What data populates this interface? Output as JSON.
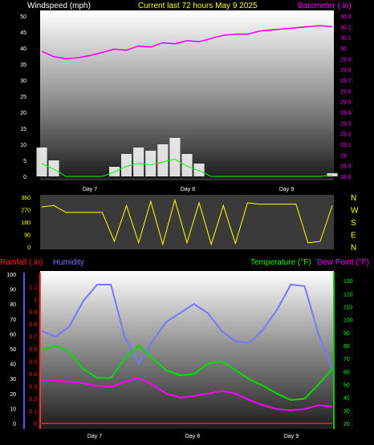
{
  "header": {
    "left": "Windspeed (mph)",
    "center": "Current last 72 hours May 9 2025",
    "right": "Barometer (.in)"
  },
  "day_labels": [
    "Day 7",
    "Day 8",
    "Day 9"
  ],
  "colors": {
    "wind_bars": "#ffffff",
    "gust_line": "#00ff00",
    "avg_line": "#004400",
    "barometer": "#ff00ff",
    "direction": "#ffff00",
    "humidity": "#7777ff",
    "temperature": "#00e000",
    "dew_point": "#ff00ff",
    "rainfall": "#ff2222",
    "label_white": "#ffffff",
    "label_yellow": "#ffff00",
    "label_green": "#00ff00",
    "label_magenta": "#ff00ff"
  },
  "chart_data": [
    {
      "type": "line",
      "title": "Current last 72 hours May 9 2025",
      "ylabel": "Windspeed (mph)",
      "ylabel_right": "Barometer (.in)",
      "ylim": [
        0,
        50
      ],
      "ylim_right": [
        28.8,
        30.3
      ],
      "yticks": [
        0,
        5,
        10,
        15,
        20,
        25,
        30,
        35,
        40,
        45,
        50
      ],
      "yticks_right": [
        "28.8",
        "28.9",
        "29",
        "29.1",
        "29.2",
        "29.3",
        "29.4",
        "29.5",
        "29.6",
        "29.7",
        "29.8",
        "29.9",
        "30",
        "30.1",
        "30.2",
        "30.3"
      ],
      "x_hours": [
        0,
        6,
        12,
        18,
        24,
        30,
        36,
        42,
        48,
        54,
        60,
        66,
        72
      ],
      "x_day_labels": [
        "Day 7",
        "Day 8",
        "Day 9"
      ],
      "series": [
        {
          "name": "Windspeed",
          "values": [
            9,
            5,
            0,
            0,
            0,
            0,
            3,
            7,
            9,
            8,
            10,
            12,
            7,
            4,
            0,
            0,
            0,
            0,
            0,
            0,
            0,
            0,
            0,
            0,
            1
          ]
        },
        {
          "name": "Barometer",
          "values": [
            29.97,
            29.92,
            29.9,
            29.91,
            29.93,
            29.96,
            29.99,
            29.98,
            30.02,
            30.01,
            30.05,
            30.04,
            30.07,
            30.06,
            30.09,
            30.12,
            30.13,
            30.13,
            30.16,
            30.17,
            30.18,
            30.19,
            30.2,
            30.21,
            30.2
          ]
        }
      ]
    },
    {
      "type": "line",
      "ylabel_right_letters": [
        "N",
        "W",
        "S",
        "E",
        "N"
      ],
      "ylim": [
        0,
        360
      ],
      "yticks": [
        0,
        90,
        180,
        270,
        360
      ],
      "x_day_labels": [
        "Day 7",
        "Day 8",
        "Day 9"
      ],
      "series": [
        {
          "name": "Wind direction",
          "values": [
            290,
            300,
            250,
            250,
            250,
            250,
            40,
            300,
            30,
            330,
            20,
            340,
            30,
            320,
            20,
            300,
            25,
            320,
            310,
            310,
            310,
            310,
            30,
            40,
            300
          ]
        }
      ]
    },
    {
      "type": "line",
      "ylabels_left": [
        "Rainfall (.in)",
        "Humidity"
      ],
      "ylabels_right": [
        "Temperature (°F)",
        "Dew Point (°F)"
      ],
      "ylim_humidity": [
        0,
        100
      ],
      "ylim_rainfall": [
        0,
        1.2
      ],
      "ylim_temperature": [
        20,
        135
      ],
      "yticks_humidity": [
        0,
        10,
        20,
        30,
        40,
        50,
        60,
        70,
        80,
        90,
        100
      ],
      "yticks_rainfall": [
        "0",
        "0.1",
        "0.2",
        "0.3",
        "0.4",
        "0.5",
        "0.6",
        "0.7",
        "0.8",
        "0.9",
        "1",
        "1.1"
      ],
      "yticks_temperature": [
        20,
        30,
        40,
        50,
        60,
        70,
        80,
        90,
        100,
        110,
        120,
        130
      ],
      "x_day_labels": [
        "Day 7",
        "Day 8",
        "Day 9"
      ],
      "series": [
        {
          "name": "Humidity",
          "values": [
            62,
            58,
            65,
            82,
            93,
            93,
            58,
            40,
            55,
            68,
            74,
            80,
            74,
            62,
            55,
            54,
            63,
            76,
            93,
            92,
            60,
            36
          ]
        },
        {
          "name": "Temperature",
          "values": [
            77,
            80,
            75,
            62,
            55,
            55,
            70,
            80,
            70,
            61,
            57,
            58,
            66,
            68,
            61,
            54,
            49,
            43,
            38,
            39,
            50,
            62
          ]
        },
        {
          "name": "Dew Point",
          "values": [
            53,
            53,
            52,
            51,
            49,
            48,
            52,
            55,
            50,
            43,
            40,
            41,
            43,
            45,
            43,
            38,
            34,
            31,
            30,
            31,
            34,
            33
          ]
        },
        {
          "name": "Rainfall",
          "values": [
            0,
            0,
            0,
            0,
            0,
            0,
            0,
            0,
            0,
            0,
            0,
            0,
            0,
            0,
            0,
            0,
            0,
            0,
            0,
            0,
            0,
            0
          ]
        }
      ]
    }
  ]
}
